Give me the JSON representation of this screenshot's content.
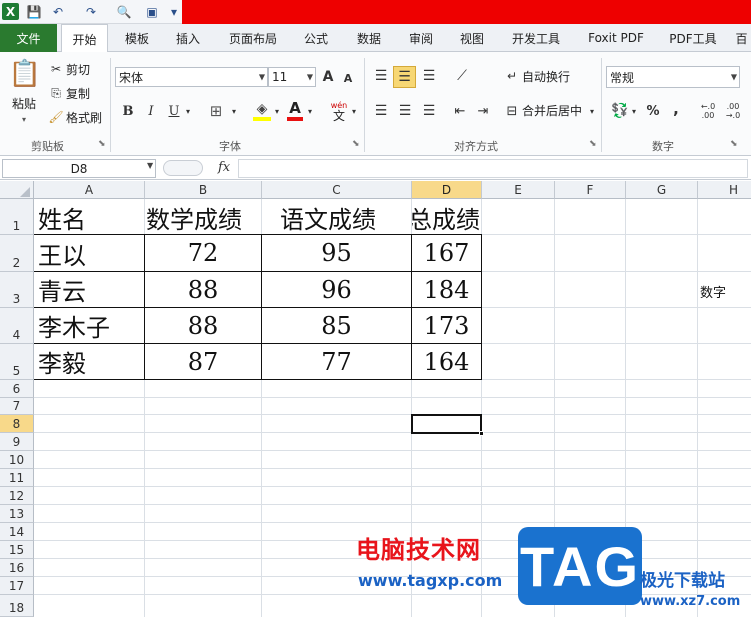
{
  "quick_access": {
    "app_icon": "X",
    "save": "💾",
    "undo": "↶",
    "redo": "↷",
    "find": "🔍",
    "more": "▾"
  },
  "tabs": [
    "文件",
    "开始",
    "模板",
    "插入",
    "页面布局",
    "公式",
    "数据",
    "审阅",
    "视图",
    "开发工具",
    "Foxit PDF",
    "PDF工具",
    "百"
  ],
  "ribbon": {
    "clipboard": {
      "paste": "粘贴",
      "cut": "剪切",
      "copy": "复制",
      "format_painter": "格式刷",
      "label": "剪贴板"
    },
    "font": {
      "font_name": "宋体",
      "font_size": "11",
      "grow": "A",
      "shrink": "A",
      "bold": "B",
      "italic": "I",
      "underline": "U",
      "border": "⊞",
      "fill": "◈",
      "font_color": "A",
      "wen": "wén",
      "wen_char": "文",
      "label": "字体"
    },
    "alignment": {
      "wrap_text": "自动换行",
      "merge_center": "合并后居中",
      "label": "对齐方式"
    },
    "number": {
      "format": "常规",
      "percent": "%",
      "comma": ",",
      "inc_decimal": "←.0 .00",
      "dec_decimal": ".00 →.0",
      "label": "数字"
    }
  },
  "formula_bar": {
    "name_box": "D8",
    "fx": "fx",
    "value": ""
  },
  "columns": [
    "A",
    "B",
    "C",
    "D",
    "E",
    "F",
    "G",
    "H"
  ],
  "rows": [
    "1",
    "2",
    "3",
    "4",
    "5",
    "6",
    "7",
    "8",
    "9",
    "10",
    "11",
    "12",
    "13",
    "14",
    "15",
    "16",
    "17",
    "18"
  ],
  "sheet": {
    "header": [
      "姓名",
      "数学成绩",
      "语文成绩",
      "总成绩"
    ],
    "data": [
      [
        "王以",
        "72",
        "95",
        "167"
      ],
      [
        "青云",
        "88",
        "96",
        "184"
      ],
      [
        "李木子",
        "88",
        "85",
        "173"
      ],
      [
        "李毅",
        "87",
        "77",
        "164"
      ]
    ],
    "h3_text": "数字"
  },
  "watermark": {
    "cn": "电脑技术网",
    "url": "www.tagxp.com",
    "logo": "TAG",
    "site_cn": "极光下载站",
    "site_url": "www.xz7.com"
  },
  "colors": {
    "file_tab": "#2a7a2f",
    "title_red": "#ee0000",
    "selected_header": "#f8d98a",
    "watermark_red": "#e8141b",
    "watermark_blue": "#1b62c4"
  }
}
